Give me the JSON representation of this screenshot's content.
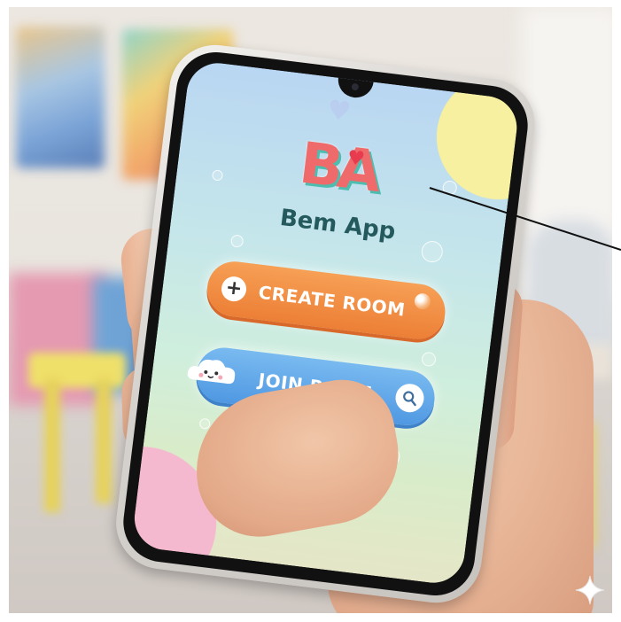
{
  "app": {
    "logo_text": "BA",
    "title": "Bem App"
  },
  "buttons": {
    "create_room": "CREATE ROOM",
    "join_room": "JOIN ROOM"
  },
  "icons": {
    "create": "plus-icon",
    "join": "search-icon",
    "decor_cloud": "cloud-icon",
    "decor_heart": "heart-icon",
    "watermark": "sparkle-icon"
  },
  "colors": {
    "create_button": "#ec7f35",
    "join_button": "#4f98e2",
    "title_text": "#245a5e",
    "logo_red": "#ef6b6b",
    "logo_teal": "#4dbdb0"
  }
}
